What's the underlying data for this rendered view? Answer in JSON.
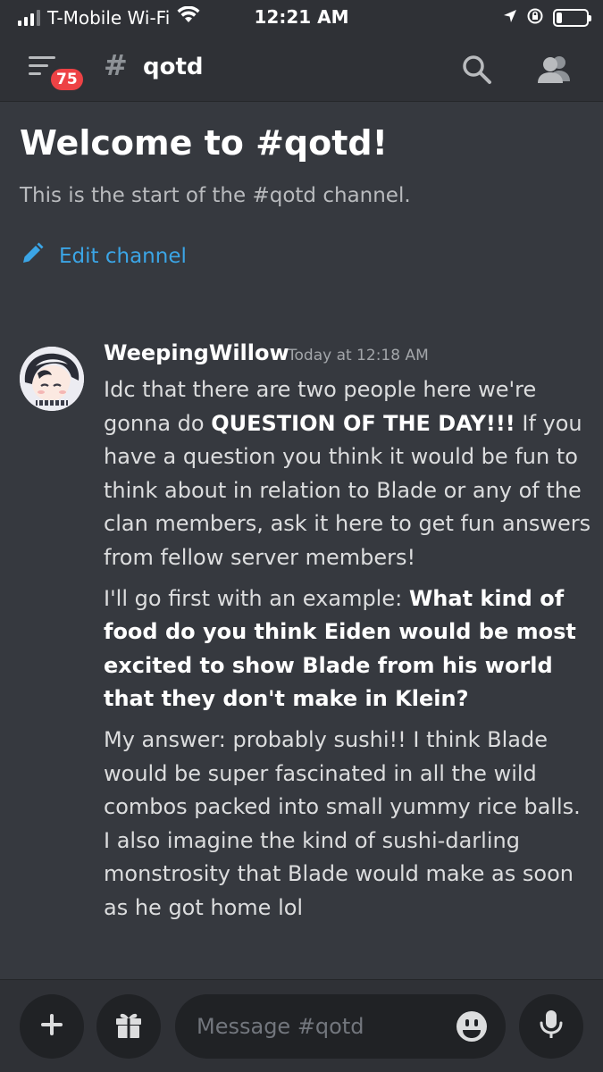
{
  "status_bar": {
    "carrier": "T-Mobile Wi-Fi",
    "time": "12:21 AM",
    "signal_bars": 3,
    "battery_level": 0.2
  },
  "header": {
    "unread_count": "75",
    "channel_hash": "#",
    "channel_name": "qotd",
    "menu_icon": "hamburger-menu-icon",
    "search_icon": "search-icon",
    "members_icon": "members-icon"
  },
  "welcome": {
    "title": "Welcome to #qotd!",
    "subtitle": "This is the start of the #qotd channel.",
    "edit_label": "Edit channel",
    "edit_icon": "pencil-icon"
  },
  "message": {
    "author": "WeepingWillow",
    "timestamp": "Today at 12:18 AM",
    "paragraphs": [
      [
        {
          "text": "Idc that there are two people here we're gonna do ",
          "bold": false
        },
        {
          "text": "QUESTION OF THE DAY!!!",
          "bold": true
        },
        {
          "text": " If you have a question you think it would be fun to think about in relation to Blade or any of the clan members, ask it here to get fun answers from fellow server members!",
          "bold": false
        }
      ],
      [
        {
          "text": "I'll go first with an example: ",
          "bold": false
        },
        {
          "text": "What kind of food do you think Eiden would be most excited to show Blade from his world that they don't make in Klein?",
          "bold": true
        }
      ],
      [
        {
          "text": "My answer: probably sushi!! I think Blade would be super fascinated in all the wild combos packed into small yummy rice balls. I also imagine the kind of sushi-darling monstrosity that Blade would make as soon as he got home lol",
          "bold": false
        }
      ]
    ]
  },
  "composer": {
    "placeholder": "Message #qotd",
    "plus_icon": "plus-icon",
    "gift_icon": "gift-icon",
    "emoji_icon": "emoji-icon",
    "mic_icon": "microphone-icon"
  },
  "colors": {
    "background": "#36393f",
    "header_bg": "#2f3136",
    "input_bg": "#202225",
    "link_blue": "#3ba5e6",
    "badge_red": "#ed4245"
  }
}
